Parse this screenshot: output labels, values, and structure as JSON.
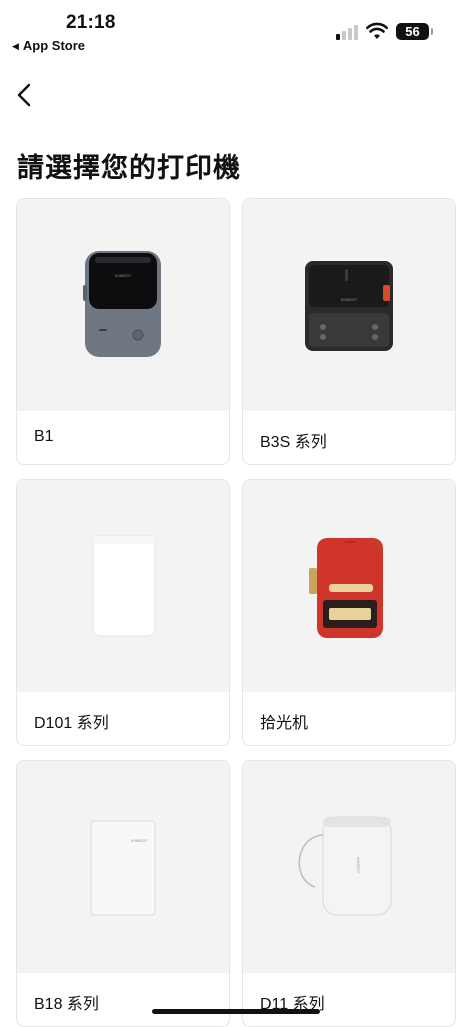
{
  "status_bar": {
    "time": "21:18",
    "back_app": "App Store",
    "battery": "56"
  },
  "page": {
    "title": "請選擇您的打印機"
  },
  "printers": [
    {
      "label": "B1",
      "icon": "b1-printer-image"
    },
    {
      "label": "B3S 系列",
      "icon": "b3s-printer-image"
    },
    {
      "label": "D101 系列",
      "icon": "d101-printer-image"
    },
    {
      "label": "拾光机",
      "icon": "shiguangji-printer-image"
    },
    {
      "label": "B18 系列",
      "icon": "b18-printer-image"
    },
    {
      "label": "D11 系列",
      "icon": "d11-printer-image"
    }
  ],
  "brand_text": "NIIMBOT"
}
